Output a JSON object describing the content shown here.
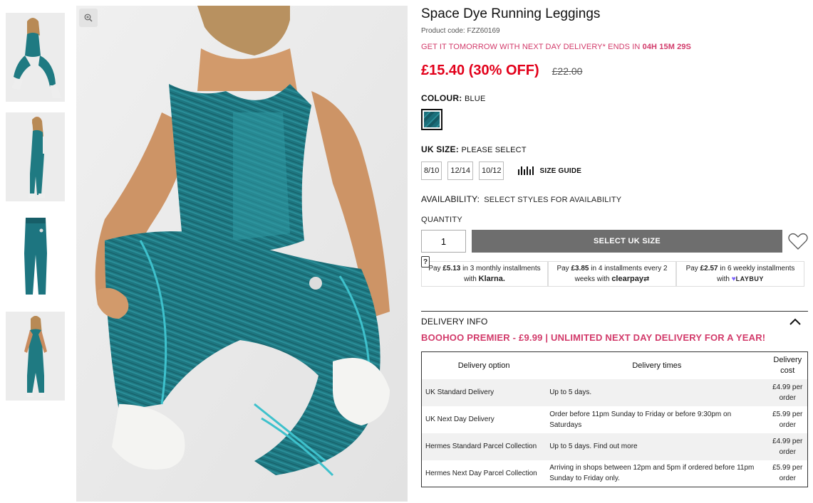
{
  "product": {
    "title": "Space Dye Running Leggings",
    "code": "Product code: FZZ60169",
    "promo_text": "GET IT TOMORROW WITH NEXT DAY DELIVERY* ENDS IN ",
    "promo_countdown": "04H 15M 29S",
    "price": "£15.40 (30% OFF)",
    "was_price": "£22.00",
    "colour_label": "COLOUR:",
    "colour_value": "BLUE",
    "size_label": "UK SIZE:",
    "size_value": "PLEASE SELECT",
    "sizes": [
      "8/10",
      "12/14",
      "10/12"
    ],
    "size_guide": "SIZE GUIDE",
    "availability_label": "AVAILABILITY:",
    "availability_value": "SELECT STYLES FOR AVAILABILITY",
    "quantity_label": "QUANTITY",
    "quantity_value": "1",
    "cta_label": "SELECT UK SIZE",
    "accent_color": "#d23a6a",
    "price_color": "#e2001a"
  },
  "payments": {
    "help": "?",
    "klarna": {
      "pre": "Pay ",
      "amount": "£5.13",
      "mid": " in 3 monthly installments with ",
      "brand": "Klarna."
    },
    "clearpay": {
      "pre": "Pay ",
      "amount": "£3.85",
      "mid": " in 4 installments every 2 weeks with ",
      "brand": "clearpay"
    },
    "laybuy": {
      "pre": "Pay ",
      "amount": "£2.57",
      "mid": " in 6 weekly installments with ",
      "brand": "LAYBUY"
    }
  },
  "delivery": {
    "title": "DELIVERY INFO",
    "premier": "BOOHOO PREMIER - £9.99 | UNLIMITED NEXT DAY DELIVERY FOR A YEAR!",
    "headers": [
      "Delivery option",
      "Delivery times",
      "Delivery cost"
    ],
    "rows": [
      {
        "option": "UK Standard Delivery",
        "times": "Up to 5 days.",
        "cost": "£4.99 per order"
      },
      {
        "option": "UK Next Day Delivery",
        "times": "Order before 11pm Sunday to Friday or before 9:30pm on Saturdays",
        "cost": "£5.99 per order"
      },
      {
        "option": "Hermes Standard Parcel Collection",
        "times": "Up to 5 days. Find out more",
        "cost": "£4.99 per order"
      },
      {
        "option": "Hermes Next Day Parcel Collection",
        "times": "Arriving in shops between 12pm and 5pm if ordered before 11pm Sunday to Friday only.",
        "cost": "£5.99 per order"
      }
    ]
  }
}
